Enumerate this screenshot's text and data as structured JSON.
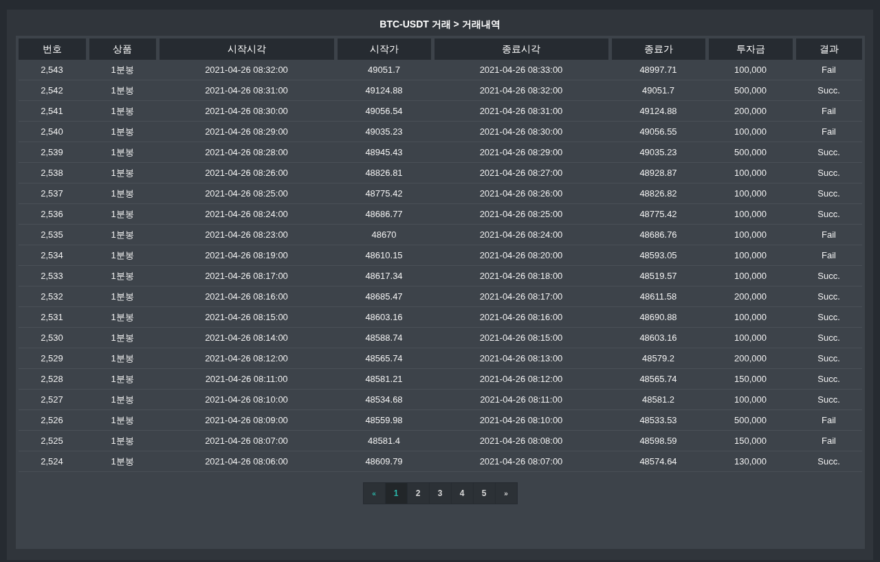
{
  "title": "BTC-USDT 거래 > 거래내역",
  "table": {
    "columns": [
      "번호",
      "상품",
      "시작시각",
      "시작가",
      "종료시각",
      "종료가",
      "투자금",
      "결과"
    ],
    "rows": [
      [
        "2,543",
        "1분봉",
        "2021-04-26 08:32:00",
        "49051.7",
        "2021-04-26 08:33:00",
        "48997.71",
        "100,000",
        "Fail"
      ],
      [
        "2,542",
        "1분봉",
        "2021-04-26 08:31:00",
        "49124.88",
        "2021-04-26 08:32:00",
        "49051.7",
        "500,000",
        "Succ."
      ],
      [
        "2,541",
        "1분봉",
        "2021-04-26 08:30:00",
        "49056.54",
        "2021-04-26 08:31:00",
        "49124.88",
        "200,000",
        "Fail"
      ],
      [
        "2,540",
        "1분봉",
        "2021-04-26 08:29:00",
        "49035.23",
        "2021-04-26 08:30:00",
        "49056.55",
        "100,000",
        "Fail"
      ],
      [
        "2,539",
        "1분봉",
        "2021-04-26 08:28:00",
        "48945.43",
        "2021-04-26 08:29:00",
        "49035.23",
        "500,000",
        "Succ."
      ],
      [
        "2,538",
        "1분봉",
        "2021-04-26 08:26:00",
        "48826.81",
        "2021-04-26 08:27:00",
        "48928.87",
        "100,000",
        "Succ."
      ],
      [
        "2,537",
        "1분봉",
        "2021-04-26 08:25:00",
        "48775.42",
        "2021-04-26 08:26:00",
        "48826.82",
        "100,000",
        "Succ."
      ],
      [
        "2,536",
        "1분봉",
        "2021-04-26 08:24:00",
        "48686.77",
        "2021-04-26 08:25:00",
        "48775.42",
        "100,000",
        "Succ."
      ],
      [
        "2,535",
        "1분봉",
        "2021-04-26 08:23:00",
        "48670",
        "2021-04-26 08:24:00",
        "48686.76",
        "100,000",
        "Fail"
      ],
      [
        "2,534",
        "1분봉",
        "2021-04-26 08:19:00",
        "48610.15",
        "2021-04-26 08:20:00",
        "48593.05",
        "100,000",
        "Fail"
      ],
      [
        "2,533",
        "1분봉",
        "2021-04-26 08:17:00",
        "48617.34",
        "2021-04-26 08:18:00",
        "48519.57",
        "100,000",
        "Succ."
      ],
      [
        "2,532",
        "1분봉",
        "2021-04-26 08:16:00",
        "48685.47",
        "2021-04-26 08:17:00",
        "48611.58",
        "200,000",
        "Succ."
      ],
      [
        "2,531",
        "1분봉",
        "2021-04-26 08:15:00",
        "48603.16",
        "2021-04-26 08:16:00",
        "48690.88",
        "100,000",
        "Succ."
      ],
      [
        "2,530",
        "1분봉",
        "2021-04-26 08:14:00",
        "48588.74",
        "2021-04-26 08:15:00",
        "48603.16",
        "100,000",
        "Succ."
      ],
      [
        "2,529",
        "1분봉",
        "2021-04-26 08:12:00",
        "48565.74",
        "2021-04-26 08:13:00",
        "48579.2",
        "200,000",
        "Succ."
      ],
      [
        "2,528",
        "1분봉",
        "2021-04-26 08:11:00",
        "48581.21",
        "2021-04-26 08:12:00",
        "48565.74",
        "150,000",
        "Succ."
      ],
      [
        "2,527",
        "1분봉",
        "2021-04-26 08:10:00",
        "48534.68",
        "2021-04-26 08:11:00",
        "48581.2",
        "100,000",
        "Succ."
      ],
      [
        "2,526",
        "1분봉",
        "2021-04-26 08:09:00",
        "48559.98",
        "2021-04-26 08:10:00",
        "48533.53",
        "500,000",
        "Fail"
      ],
      [
        "2,525",
        "1분봉",
        "2021-04-26 08:07:00",
        "48581.4",
        "2021-04-26 08:08:00",
        "48598.59",
        "150,000",
        "Fail"
      ],
      [
        "2,524",
        "1분봉",
        "2021-04-26 08:06:00",
        "48609.79",
        "2021-04-26 08:07:00",
        "48574.64",
        "130,000",
        "Succ."
      ]
    ]
  },
  "pagination": [
    {
      "kind": "prev",
      "label": "«",
      "selected": false,
      "accent": true
    },
    {
      "kind": "page",
      "label": "1",
      "selected": true
    },
    {
      "kind": "page",
      "label": "2",
      "selected": false
    },
    {
      "kind": "page",
      "label": "3",
      "selected": false
    },
    {
      "kind": "page",
      "label": "4",
      "selected": false
    },
    {
      "kind": "page",
      "label": "5",
      "selected": false
    },
    {
      "kind": "next",
      "label": "»",
      "selected": false,
      "accent": false
    }
  ]
}
